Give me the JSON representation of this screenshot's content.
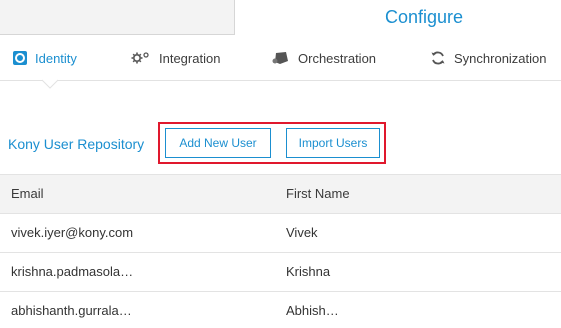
{
  "header": {
    "title": "Configure"
  },
  "tabs": [
    {
      "label": "Identity",
      "icon": "identity-icon",
      "active": true
    },
    {
      "label": "Integration",
      "icon": "gears-icon",
      "active": false
    },
    {
      "label": "Orchestration",
      "icon": "orchestration-icon",
      "active": false
    },
    {
      "label": "Synchronization",
      "icon": "sync-icon",
      "active": false
    }
  ],
  "repository": {
    "label": "Kony User Repository",
    "add_button": "Add New User",
    "import_button": "Import Users"
  },
  "table": {
    "columns": [
      "Email",
      "First Name"
    ],
    "rows": [
      {
        "email": "vivek.iyer@kony.com",
        "first_name": "Vivek"
      },
      {
        "email": "krishna.padmasola…",
        "first_name": "Krishna"
      },
      {
        "email": "abhishanth.gurrala…",
        "first_name": "Abhish…"
      }
    ]
  },
  "colors": {
    "accent": "#1b8fd0",
    "highlight": "#e0182d"
  }
}
